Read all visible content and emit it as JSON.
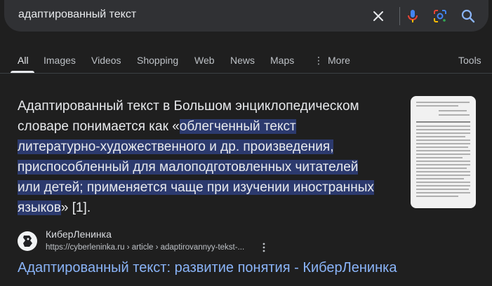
{
  "search": {
    "query": "адаптированный текст",
    "icons": [
      "clear-icon",
      "microphone-icon",
      "google-lens-icon",
      "search-icon"
    ]
  },
  "tabs": {
    "all": "All",
    "images": "Images",
    "videos": "Videos",
    "shopping": "Shopping",
    "web": "Web",
    "news": "News",
    "maps": "Maps",
    "more": "More",
    "tools": "Tools"
  },
  "snippet": {
    "intro": "Адаптированный текст в Большом энциклопедическом словаре понимается как «",
    "highlight_1": "облегченный текст",
    "highlight_2": "литературно-художественного и др. произведения,",
    "highlight_3": "приспособленный для малоподготовленных читателей",
    "highlight_4": "или детей; применяется чаще при изучении иностранных",
    "highlight_5": "языков",
    "outro": "» [1]."
  },
  "result": {
    "site_name": "КиберЛенинка",
    "url": "https://cyberleninka.ru › article › adaptirovannyy-tekst-...",
    "title": "Адаптированный текст: развитие понятия - КиберЛенинка"
  },
  "colors": {
    "background": "#1f1f1f",
    "searchbar": "#303134",
    "highlight": "#2c3a6e",
    "link": "#8ab4f8"
  }
}
